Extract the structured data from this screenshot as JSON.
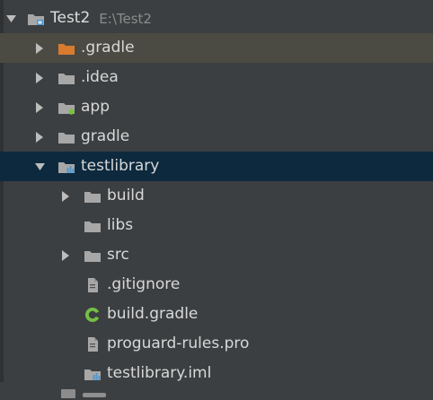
{
  "tree": {
    "root": {
      "label": "Test2",
      "path": "E:\\Test2"
    },
    "items": [
      {
        "label": ".gradle",
        "icon": "folder-orange-icon"
      },
      {
        "label": ".idea",
        "icon": "folder-icon"
      },
      {
        "label": "app",
        "icon": "module-folder-icon"
      },
      {
        "label": "gradle",
        "icon": "folder-icon"
      },
      {
        "label": "testlibrary",
        "icon": "library-module-icon"
      },
      {
        "label": "build",
        "icon": "folder-icon"
      },
      {
        "label": "libs",
        "icon": "folder-icon"
      },
      {
        "label": "src",
        "icon": "folder-icon"
      },
      {
        "label": ".gitignore",
        "icon": "text-file-icon"
      },
      {
        "label": "build.gradle",
        "icon": "gradle-file-icon"
      },
      {
        "label": "proguard-rules.pro",
        "icon": "text-file-icon"
      },
      {
        "label": "testlibrary.iml",
        "icon": "iml-file-icon"
      }
    ]
  },
  "colors": {
    "background": "#3c3f41",
    "selected": "#0d293e",
    "hover": "#4b4b43",
    "text": "#d8d8d8",
    "path": "#8b8b8b",
    "folder": "#a7a7a7",
    "orange_folder": "#d97b2e",
    "module_badge": "#7ac143",
    "library_badge": "#4f95cf",
    "gradle_green": "#74c045"
  }
}
